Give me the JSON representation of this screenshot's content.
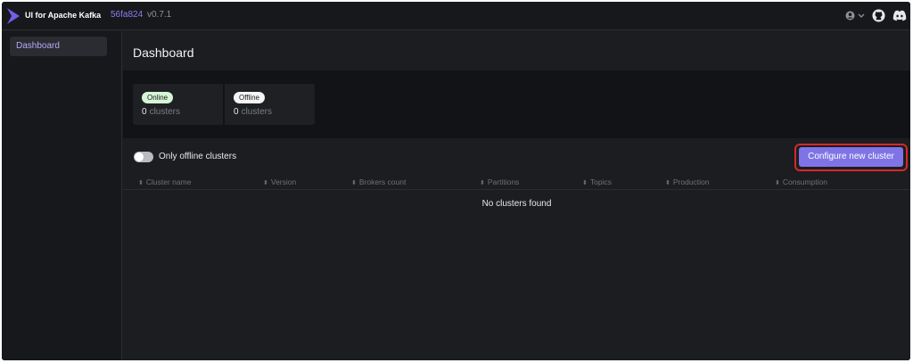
{
  "header": {
    "app_title": "UI for Apache Kafka",
    "commit": "56fa824",
    "version": "v0.7.1"
  },
  "sidebar": {
    "items": [
      {
        "label": "Dashboard",
        "active": true
      }
    ]
  },
  "main": {
    "title": "Dashboard",
    "stats": {
      "online": {
        "badge": "Online",
        "count": "0",
        "unit": "clusters"
      },
      "offline": {
        "badge": "Offline",
        "count": "0",
        "unit": "clusters"
      }
    },
    "toggle_label": "Only offline clusters",
    "configure_button": "Configure new cluster",
    "columns": [
      "Cluster name",
      "Version",
      "Brokers count",
      "Partitions",
      "Topics",
      "Production",
      "Consumption"
    ],
    "empty_message": "No clusters found"
  },
  "colors": {
    "accent": "#7f74e6",
    "highlight_outline": "#d42a26"
  },
  "icons": [
    "kafka-logo-icon",
    "user-icon",
    "chevron-down-icon",
    "github-icon",
    "discord-icon",
    "sort-icon"
  ]
}
